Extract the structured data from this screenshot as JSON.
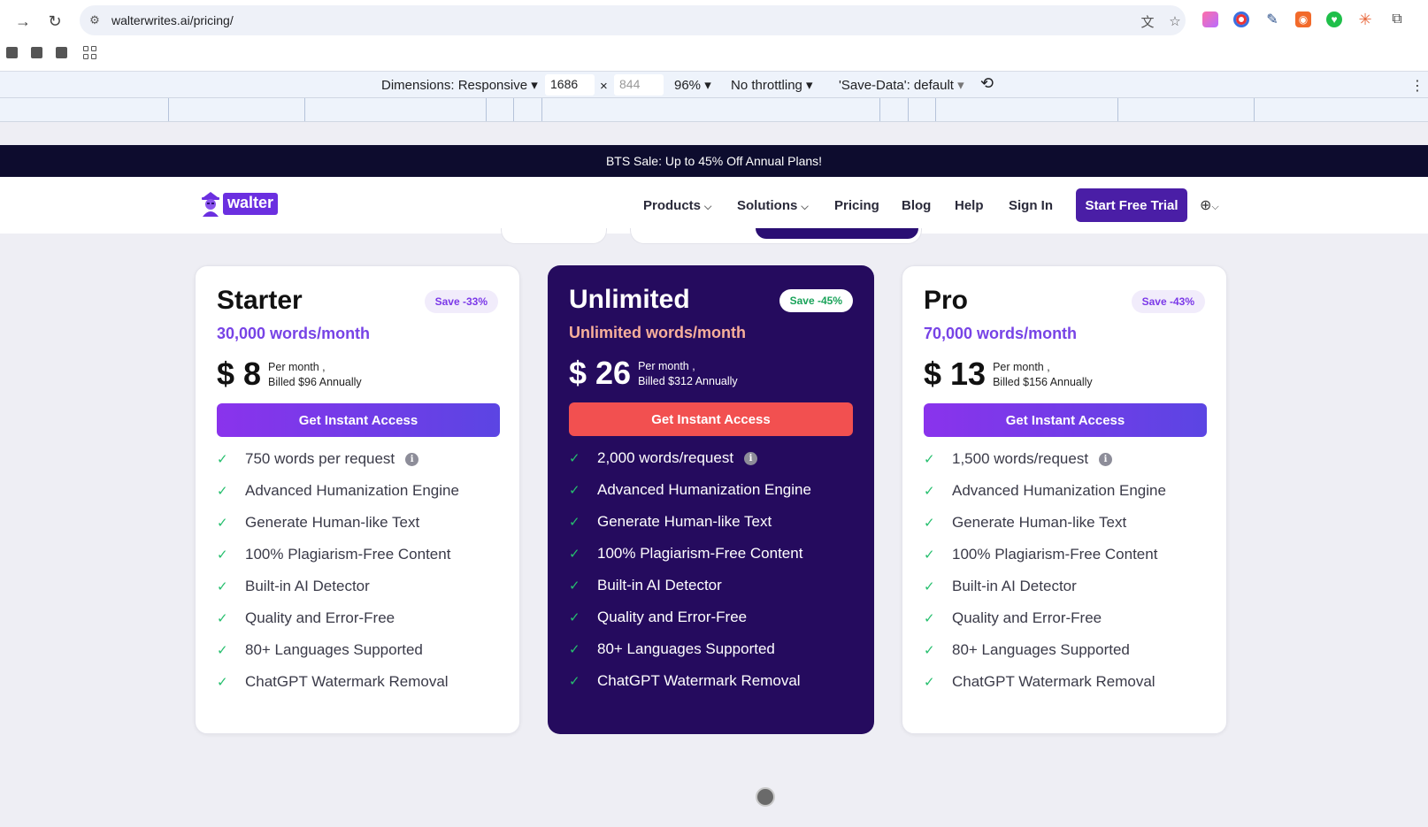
{
  "browser": {
    "url": "walterwrites.ai/pricing/"
  },
  "devtools": {
    "dimensions_label": "Dimensions: Responsive",
    "width": "1686",
    "times": "×",
    "height_placeholder": "844",
    "zoom": "96%",
    "throttling": "No throttling",
    "save_data": "'Save-Data': default"
  },
  "promo": {
    "text": "BTS Sale: Up to 45% Off Annual Plans!"
  },
  "header": {
    "logo_text": "walter",
    "nav": [
      "Products",
      "Solutions",
      "Pricing",
      "Blog",
      "Help",
      "Sign In"
    ],
    "cta": "Start Free Trial"
  },
  "plans": [
    {
      "name": "Starter",
      "badge": "Save -33%",
      "words": "30,000 words/month",
      "price": "$ 8",
      "period": "Per month ,",
      "billed": "Billed $96 Annually",
      "button": "Get Instant Access",
      "features": [
        "750 words per request",
        "Advanced Humanization Engine",
        "Generate Human-like Text",
        "100% Plagiarism-Free Content",
        "Built-in AI Detector",
        "Quality and Error-Free",
        "80+ Languages Supported",
        "ChatGPT Watermark Removal"
      ]
    },
    {
      "name": "Unlimited",
      "badge": "Save -45%",
      "words": "Unlimited words/month",
      "price": "$ 26",
      "period": "Per month ,",
      "billed": "Billed $312 Annually",
      "button": "Get Instant Access",
      "features": [
        "2,000 words/request",
        "Advanced Humanization Engine",
        "Generate Human-like Text",
        "100% Plagiarism-Free Content",
        "Built-in AI Detector",
        "Quality and Error-Free",
        "80+ Languages Supported",
        "ChatGPT Watermark Removal"
      ]
    },
    {
      "name": "Pro",
      "badge": "Save -43%",
      "words": "70,000 words/month",
      "price": "$ 13",
      "period": "Per month ,",
      "billed": "Billed $156 Annually",
      "button": "Get Instant Access",
      "features": [
        "1,500 words/request",
        "Advanced Humanization Engine",
        "Generate Human-like Text",
        "100% Plagiarism-Free Content",
        "Built-in AI Detector",
        "Quality and Error-Free",
        "80+ Languages Supported",
        "ChatGPT Watermark Removal"
      ]
    }
  ],
  "icons": {
    "info": "i",
    "check": "✓"
  },
  "colors": {
    "brand": "#6b2fe0",
    "promo_bg": "#0d0c2e",
    "featured_card": "#250b5e",
    "featured_button": "#f25050",
    "check": "#26bf6e"
  }
}
